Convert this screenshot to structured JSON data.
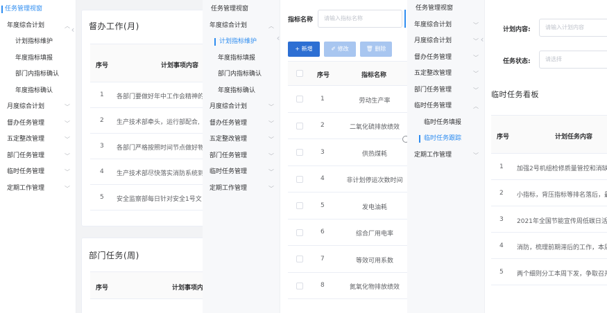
{
  "colors": {
    "accent": "#2d8cf0",
    "primary_button": "#2d6fd3",
    "disabled_button": "#a8c6f0"
  },
  "panel1": {
    "menu": [
      {
        "label": "任务管理视窗",
        "active": true
      },
      {
        "label": "年度综合计划",
        "chevron": "︿"
      },
      {
        "label": "计划指标维护"
      },
      {
        "label": "年度指标填报"
      },
      {
        "label": "部门内指标确认"
      },
      {
        "label": "年度指标确认"
      },
      {
        "label": "月度综合计划",
        "chevron": "﹀"
      },
      {
        "label": "督办任务管理",
        "chevron": "﹀"
      },
      {
        "label": "五定整改管理",
        "chevron": "﹀"
      },
      {
        "label": "部门任务管理",
        "chevron": "﹀"
      },
      {
        "label": "临时任务管理",
        "chevron": "﹀"
      },
      {
        "label": "定期工作管理",
        "chevron": "﹀"
      }
    ],
    "collapse_icon": "‹",
    "card1": {
      "title": "督办工作(月)",
      "headers": [
        "序号",
        "计划事项内容"
      ],
      "rows": [
        [
          "1",
          "各部门要做好年中工作会精神的"
        ],
        [
          "2",
          "生产技术部牵头，运行部配合,"
        ],
        [
          "3",
          "各部门严格按照时间节点做好物"
        ],
        [
          "4",
          "生产技术部尽快落实消防系统到"
        ],
        [
          "5",
          "安全监察部每日针对安全1号文"
        ]
      ]
    },
    "card2": {
      "title": "部门任务(周)",
      "headers": [
        "序号",
        "计划事项内容"
      ]
    }
  },
  "panel2": {
    "menu": [
      {
        "label": "任务管理视窗"
      },
      {
        "label": "年度综合计划",
        "chevron": "︿"
      },
      {
        "label": "计划指标维护",
        "active": true
      },
      {
        "label": "年度指标填报"
      },
      {
        "label": "部门内指标确认"
      },
      {
        "label": "年度指标确认"
      },
      {
        "label": "月度综合计划",
        "chevron": "﹀"
      },
      {
        "label": "督办任务管理",
        "chevron": "﹀"
      },
      {
        "label": "五定整改管理",
        "chevron": "﹀"
      },
      {
        "label": "部门任务管理",
        "chevron": "﹀"
      },
      {
        "label": "临时任务管理",
        "chevron": "﹀"
      },
      {
        "label": "定期工作管理",
        "chevron": "﹀"
      }
    ],
    "collapse_icon": "‹",
    "search_label": "指标名称",
    "search_placeholder": "请输入指标名称",
    "buttons": {
      "add": "+ 新增",
      "edit": "✐ 修改",
      "delete": "🗑 删除"
    },
    "headers": [
      "序号",
      "指标名称"
    ],
    "rows": [
      [
        "1",
        "劳动生产率"
      ],
      [
        "2",
        "二氧化硫排放绩效"
      ],
      [
        "3",
        "供热煤耗"
      ],
      [
        "4",
        "非计划停运次数时间"
      ],
      [
        "5",
        "发电油耗"
      ],
      [
        "6",
        "综合厂用电率"
      ],
      [
        "7",
        "等效可用系数"
      ],
      [
        "8",
        "氮氧化物排放绩效"
      ]
    ]
  },
  "panel3": {
    "menu": [
      {
        "label": "任务管理视窗"
      },
      {
        "label": "年度综合计划",
        "chevron": "﹀"
      },
      {
        "label": "月度综合计划",
        "chevron": "﹀"
      },
      {
        "label": "督办任务管理",
        "chevron": "﹀"
      },
      {
        "label": "五定整改管理",
        "chevron": "﹀"
      },
      {
        "label": "部门任务管理",
        "chevron": "﹀"
      },
      {
        "label": "临时任务管理",
        "chevron": "︿"
      },
      {
        "label": "临时任务填报"
      },
      {
        "label": "临时任务跟踪",
        "active": true
      },
      {
        "label": "定期工作管理",
        "chevron": "﹀"
      }
    ],
    "collapse_icon": "‹",
    "plan_label": "计划内容:",
    "plan_placeholder": "请输入计划内容",
    "status_label": "任务状态:",
    "status_placeholder": "请选择",
    "board_title": "临时任务看板",
    "headers": [
      "序号",
      "计划任务内容"
    ],
    "rows": [
      [
        "1",
        "加强2号机组检修质量管控和消缺,"
      ],
      [
        "2",
        "小指标，背压指标等排名落后，最"
      ],
      [
        "3",
        "2021年全国节能宣传周低碳日活动"
      ],
      [
        "4",
        "消防，梳理前期滞后的工作，本周"
      ],
      [
        "5",
        "两个细则分工本周下发，争取召开"
      ]
    ]
  }
}
